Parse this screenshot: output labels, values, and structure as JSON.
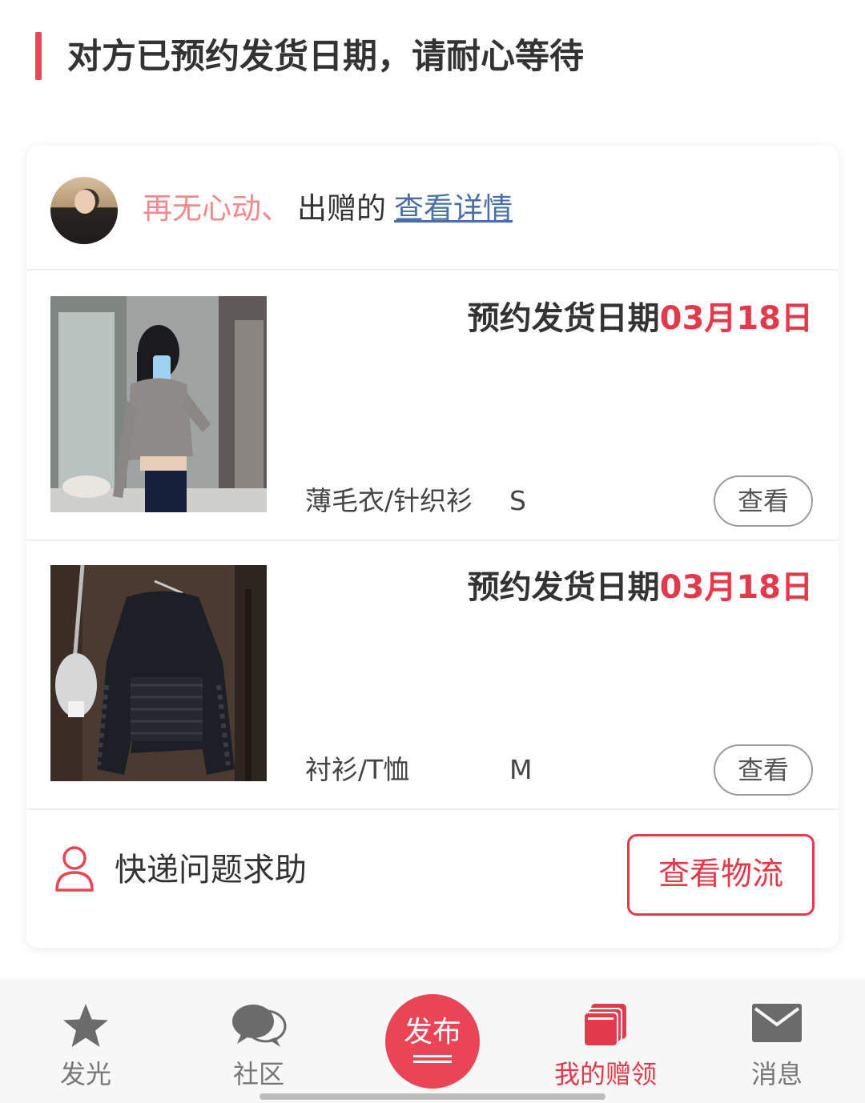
{
  "header": {
    "title": "对方已预约发货日期，请耐心等待"
  },
  "donor": {
    "name": "再无心动、",
    "suffix": "出赠的",
    "detail_link": "查看详情"
  },
  "items": [
    {
      "ship_prefix": "预约发货日期",
      "ship_date": "03月18日",
      "category": "薄毛衣/针织衫",
      "size": "S",
      "view_label": "查看"
    },
    {
      "ship_prefix": "预约发货日期",
      "ship_date": "03月18日",
      "category": "衬衫/T恤",
      "size": "M",
      "view_label": "查看"
    }
  ],
  "footer": {
    "help_text": "快递问题求助",
    "logistics_label": "查看物流"
  },
  "tabbar": {
    "tabs": [
      {
        "label": "发光",
        "icon": "star-icon"
      },
      {
        "label": "社区",
        "icon": "chat-bubbles-icon"
      },
      {
        "label": "发布",
        "icon": "publish-button"
      },
      {
        "label": "我的赠领",
        "icon": "cards-icon",
        "active": true
      },
      {
        "label": "消息",
        "icon": "mail-icon"
      }
    ]
  },
  "colors": {
    "accent": "#e23a4b",
    "donor_name": "#f08a8e",
    "link": "#4a6fa5"
  }
}
